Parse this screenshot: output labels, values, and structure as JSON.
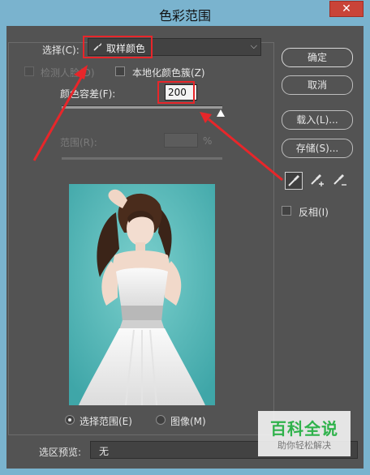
{
  "dialog": {
    "title": "色彩范围",
    "close_glyph": "✕"
  },
  "select": {
    "label": "选择(C):",
    "value": "取样颜色",
    "chevron": "⌵"
  },
  "options": {
    "detect_faces": "检测人脸(D)",
    "localized_clusters": "本地化颜色簇(Z)"
  },
  "tolerance": {
    "label": "颜色容差(F):",
    "value": "200",
    "slider_fraction": 0.97
  },
  "range": {
    "label": "范围(R):",
    "unit": "%"
  },
  "preview_mode": {
    "selection_label": "选择范围(E)",
    "image_label": "图像(M)",
    "selected": "selection"
  },
  "selection_preview": {
    "label": "选区预览:",
    "value": "无"
  },
  "buttons": {
    "ok": "确定",
    "cancel": "取消",
    "load": "载入(L)...",
    "save": "存储(S)..."
  },
  "tools": [
    "eyedropper-icon",
    "eyedropper-add-icon",
    "eyedropper-subtract-icon"
  ],
  "invert": {
    "label": "反相(I)",
    "checked": false
  },
  "watermark": {
    "title": "百科全说",
    "subtitle": "助你轻松解决"
  },
  "colors": {
    "panel": "#535353",
    "highlight": "#e8262a",
    "photo_bg": "#5bb8b6",
    "window_frame": "#7ab3ce"
  }
}
